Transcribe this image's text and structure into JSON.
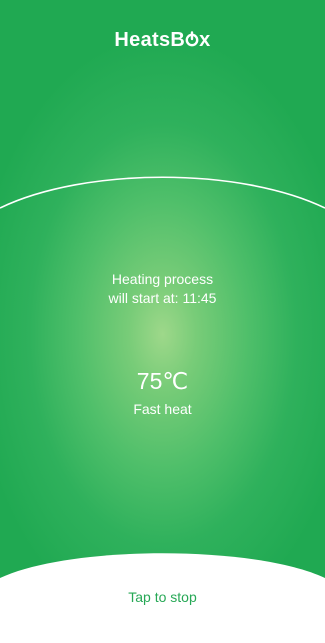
{
  "app": {
    "brand_prefix": "HeatsB",
    "brand_suffix": "x"
  },
  "status": {
    "line1": "Heating process",
    "line2": "will start at: 11:45"
  },
  "heating": {
    "temperature": "75℃",
    "mode": "Fast heat"
  },
  "actions": {
    "stop_label": "Tap to stop"
  },
  "colors": {
    "green": "#20a952",
    "light_center": "#9ed88a",
    "stop_text": "#27a856"
  }
}
